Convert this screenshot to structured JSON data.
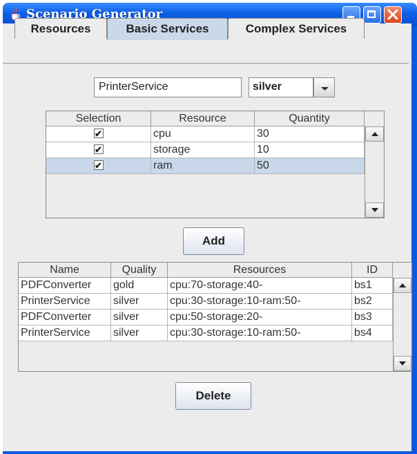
{
  "window": {
    "title": "Scenario Generator"
  },
  "tabs": [
    {
      "label": "Resources"
    },
    {
      "label": "Basic Services"
    },
    {
      "label": "Complex Services"
    }
  ],
  "basic_services": {
    "service_name_value": "PrinterService",
    "quality_selected": "silver",
    "check_mark": "✔",
    "resource_table": {
      "columns": [
        "Selection",
        "Resource",
        "Quantity"
      ],
      "rows": [
        {
          "selected": true,
          "resource": "cpu",
          "quantity": "30"
        },
        {
          "selected": true,
          "resource": "storage",
          "quantity": "10"
        },
        {
          "selected": true,
          "resource": "ram",
          "quantity": "50"
        }
      ]
    },
    "add_label": "Add",
    "services_table": {
      "columns": [
        "Name",
        "Quality",
        "Resources",
        "ID"
      ],
      "rows": [
        {
          "name": "PDFConverter",
          "quality": "gold",
          "resources": "cpu:70-storage:40-",
          "id": "bs1"
        },
        {
          "name": "PrinterService",
          "quality": "silver",
          "resources": "cpu:30-storage:10-ram:50-",
          "id": "bs2"
        },
        {
          "name": "PDFConverter",
          "quality": "silver",
          "resources": "cpu:50-storage:20-",
          "id": "bs3"
        },
        {
          "name": "PrinterService",
          "quality": "silver",
          "resources": "cpu:30-storage:10-ram:50-",
          "id": "bs4"
        }
      ]
    },
    "delete_label": "Delete"
  },
  "colors": {
    "title_bar": "#0d5fe6",
    "selected_row": "#c8d8ea",
    "active_tab": "#c9d9ea"
  }
}
